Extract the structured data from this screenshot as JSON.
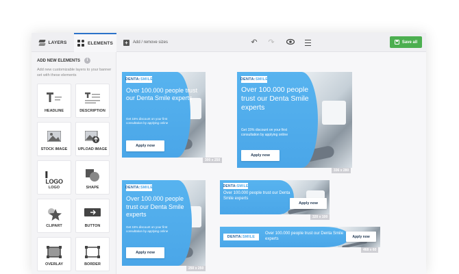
{
  "tabs": {
    "layers": "LAYERS",
    "elements": "ELEMENTS"
  },
  "toolbar": {
    "add_remove": "Add / remove sizes",
    "save": "Save all"
  },
  "panel": {
    "title": "ADD NEW ELEMENTS",
    "info": "i",
    "description": "Add new customizable layers to your banner set with these elements",
    "elements": [
      "HEADLINE",
      "DESCRIPTION",
      "STOCK IMAGE",
      "UPLOAD IMAGE",
      "LOGO",
      "SHAPE",
      "CLIPART",
      "BUTTON",
      "OVERLAY",
      "BORDER"
    ],
    "logo_glyph": "LOGO"
  },
  "ad": {
    "logo_a": "DENTA",
    "logo_b": "SMILE",
    "headline": "Over 100.000 people trust our Denta Smile experts",
    "subtext": "Get 15% discount on your first consultation by applying online",
    "cta": "Apply now"
  },
  "sizes": [
    "300 x 250",
    "336 x 280",
    "250 x 250",
    "320 x 100",
    "468 x 60"
  ],
  "colors": {
    "accent": "#2b72c9",
    "banner_blue": "#4aa6e8",
    "save_green": "#4caf50"
  }
}
